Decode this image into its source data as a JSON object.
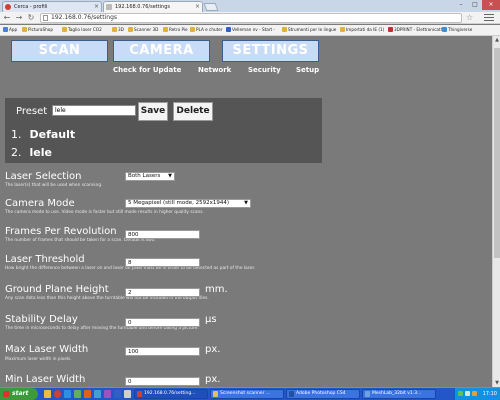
{
  "browser": {
    "tabs": [
      {
        "label": "Cerca - profili",
        "active": false
      },
      {
        "label": "192.168.0.76/settings",
        "active": true
      }
    ],
    "url": "192.168.0.76/settings",
    "bookmarks": [
      "App",
      "PicturaShop",
      "Taglio laser CO2",
      "3D",
      "Scanner 3D",
      "Retro Pie",
      "PLA e chuter",
      "Velleman nv - Start -",
      "Strumenti per le lingue",
      "Importati da IE (1)",
      "3DPRINT - Elettronicath",
      "Thingiverse"
    ]
  },
  "nav": {
    "scan": "SCAN",
    "camera": "CAMERA",
    "settings": "SETTINGS",
    "sub": [
      "Check for Update",
      "Network",
      "Security",
      "Setup"
    ]
  },
  "preset": {
    "label": "Preset",
    "input_value": "lele",
    "save": "Save",
    "delete": "Delete",
    "items": [
      {
        "num": "1.",
        "name": "Default"
      },
      {
        "num": "2.",
        "name": "lele"
      }
    ]
  },
  "settings": {
    "laser_selection": {
      "title": "Laser Selection",
      "desc": "The laser(s) that will be used when scanning.",
      "value": "Both Lasers"
    },
    "camera_mode": {
      "title": "Camera Mode",
      "desc": "The camera mode to use. Video mode is faster but still mode results in higher quality scans.",
      "value": "5 Megapixel (still mode, 2592x1944)"
    },
    "frames_per_rev": {
      "title": "Frames Per Revolution",
      "desc": "The number of frames that should be taken for a scan. Default is 800.",
      "value": "800"
    },
    "laser_threshold": {
      "title": "Laser Threshold",
      "desc": "How bright the difference between a laser on and laser off pixel must be in order to be detected as part of the laser.",
      "value": "8"
    },
    "ground_plane": {
      "title": "Ground Plane Height",
      "desc": "Any scan data less than this height above the turntable will not be included in the output files.",
      "value": "2",
      "unit": "mm."
    },
    "stability_delay": {
      "title": "Stability Delay",
      "desc": "The time in microseconds to delay after moving the turntable and before taking a picture.",
      "value": "0",
      "unit": "μs"
    },
    "max_laser_width": {
      "title": "Max Laser Width",
      "desc": "Maximum laser width in pixels.",
      "value": "100",
      "unit": "px."
    },
    "min_laser_width": {
      "title": "Min Laser Width",
      "value": "0",
      "unit": "px."
    }
  },
  "taskbar": {
    "start": "start",
    "tasks": [
      "192.168.0.76/setting...",
      "Screenshot scanner ...",
      "Adobe Photoshop CS4",
      "MeshLab_32bit v1.3..."
    ],
    "clock": "17:10"
  }
}
